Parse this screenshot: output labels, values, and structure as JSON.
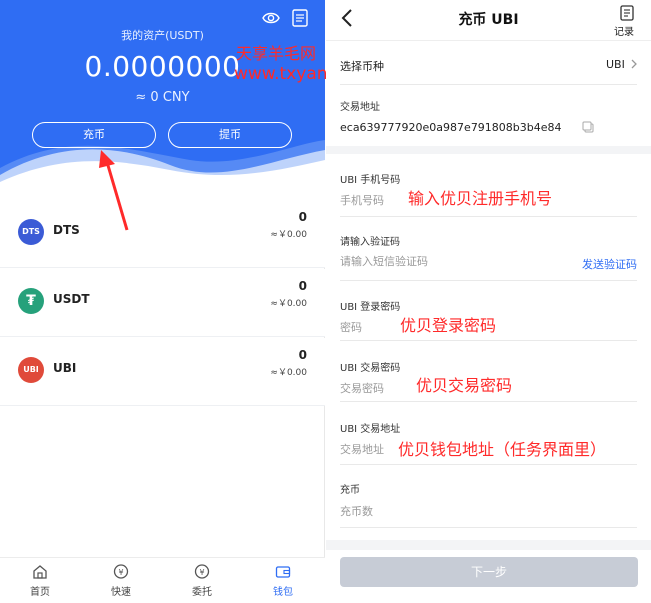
{
  "left": {
    "asset_title": "我的资产(USDT)",
    "asset_value": "0.0000000",
    "asset_cny": "≈ 0 CNY",
    "deposit_label": "充币",
    "withdraw_label": "提币",
    "watermark_text": "天享羊毛网",
    "watermark_url": "www.txyangmao.cn",
    "coins": [
      {
        "name": "DTS",
        "icon_text": "DTS",
        "color": "#3b5bd6",
        "amount": "0",
        "cny": "≈￥0.00"
      },
      {
        "name": "USDT",
        "icon_text": "₮",
        "color": "#26a17b",
        "amount": "0",
        "cny": "≈￥0.00"
      },
      {
        "name": "UBI",
        "icon_text": "UBI",
        "color": "#e04a3a",
        "amount": "0",
        "cny": "≈￥0.00"
      }
    ],
    "tabs": [
      {
        "label": "首页",
        "icon": "home-icon"
      },
      {
        "label": "快速",
        "icon": "yen-circle-icon"
      },
      {
        "label": "委托",
        "icon": "yen-circle-icon"
      },
      {
        "label": "钱包",
        "icon": "wallet-icon"
      }
    ]
  },
  "right": {
    "title": "充币 UBI",
    "record_label": "记录",
    "currency_label": "选择币种",
    "currency_value": "UBI",
    "address_label": "交易地址",
    "address_value": "eca639777920e0a987e791808b3b4e84",
    "phone_label": "UBI 手机号码",
    "phone_placeholder": "手机号码",
    "phone_note": "输入优贝注册手机号",
    "code_label": "请输入验证码",
    "code_placeholder": "请输入短信验证码",
    "send_code": "发送验证码",
    "login_pwd_label": "UBI 登录密码",
    "login_pwd_placeholder": "密码",
    "login_pwd_note": "优贝登录密码",
    "trade_pwd_label": "UBI 交易密码",
    "trade_pwd_placeholder": "交易密码",
    "trade_pwd_note": "优贝交易密码",
    "trade_addr_label": "UBI 交易地址",
    "trade_addr_placeholder": "交易地址",
    "trade_addr_note": "优贝钱包地址（任务界面里）",
    "amount_label": "充币",
    "amount_placeholder": "充币数",
    "next_label": "下一步"
  },
  "colors": {
    "primary": "#2f6df3",
    "annotation_red": "#ff2a2a",
    "disabled_button": "#c7ccd6"
  }
}
